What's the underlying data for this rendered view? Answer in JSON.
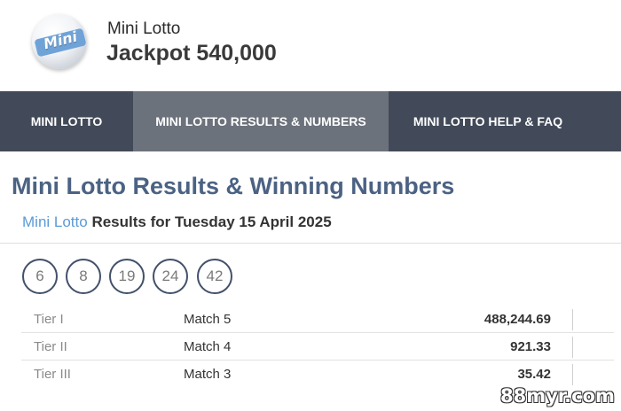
{
  "header": {
    "logo_text": "Mini",
    "title": "Mini Lotto",
    "jackpot": "Jackpot 540,000"
  },
  "nav": {
    "items": [
      {
        "label": "MINI LOTTO",
        "active": false
      },
      {
        "label": "MINI LOTTO RESULTS & NUMBERS",
        "active": true
      },
      {
        "label": "MINI LOTTO HELP & FAQ",
        "active": false
      }
    ]
  },
  "main": {
    "page_title": "Mini Lotto Results & Winning Numbers",
    "results_link": "Mini Lotto",
    "results_heading": "Results for Tuesday 15 April 2025",
    "winning_numbers": [
      "6",
      "8",
      "19",
      "24",
      "42"
    ],
    "prize_table": [
      {
        "tier": "Tier I",
        "match": "Match 5",
        "amount": "488,244.69"
      },
      {
        "tier": "Tier II",
        "match": "Match 4",
        "amount": "921.33"
      },
      {
        "tier": "Tier III",
        "match": "Match 3",
        "amount": "35.42"
      }
    ]
  },
  "watermark": "88myr.com",
  "colors": {
    "nav_bg": "#424a59",
    "nav_active_bg": "#6c727c",
    "title_color": "#4b6283",
    "link_color": "#5b9bd5",
    "ball_border": "#42506a"
  }
}
